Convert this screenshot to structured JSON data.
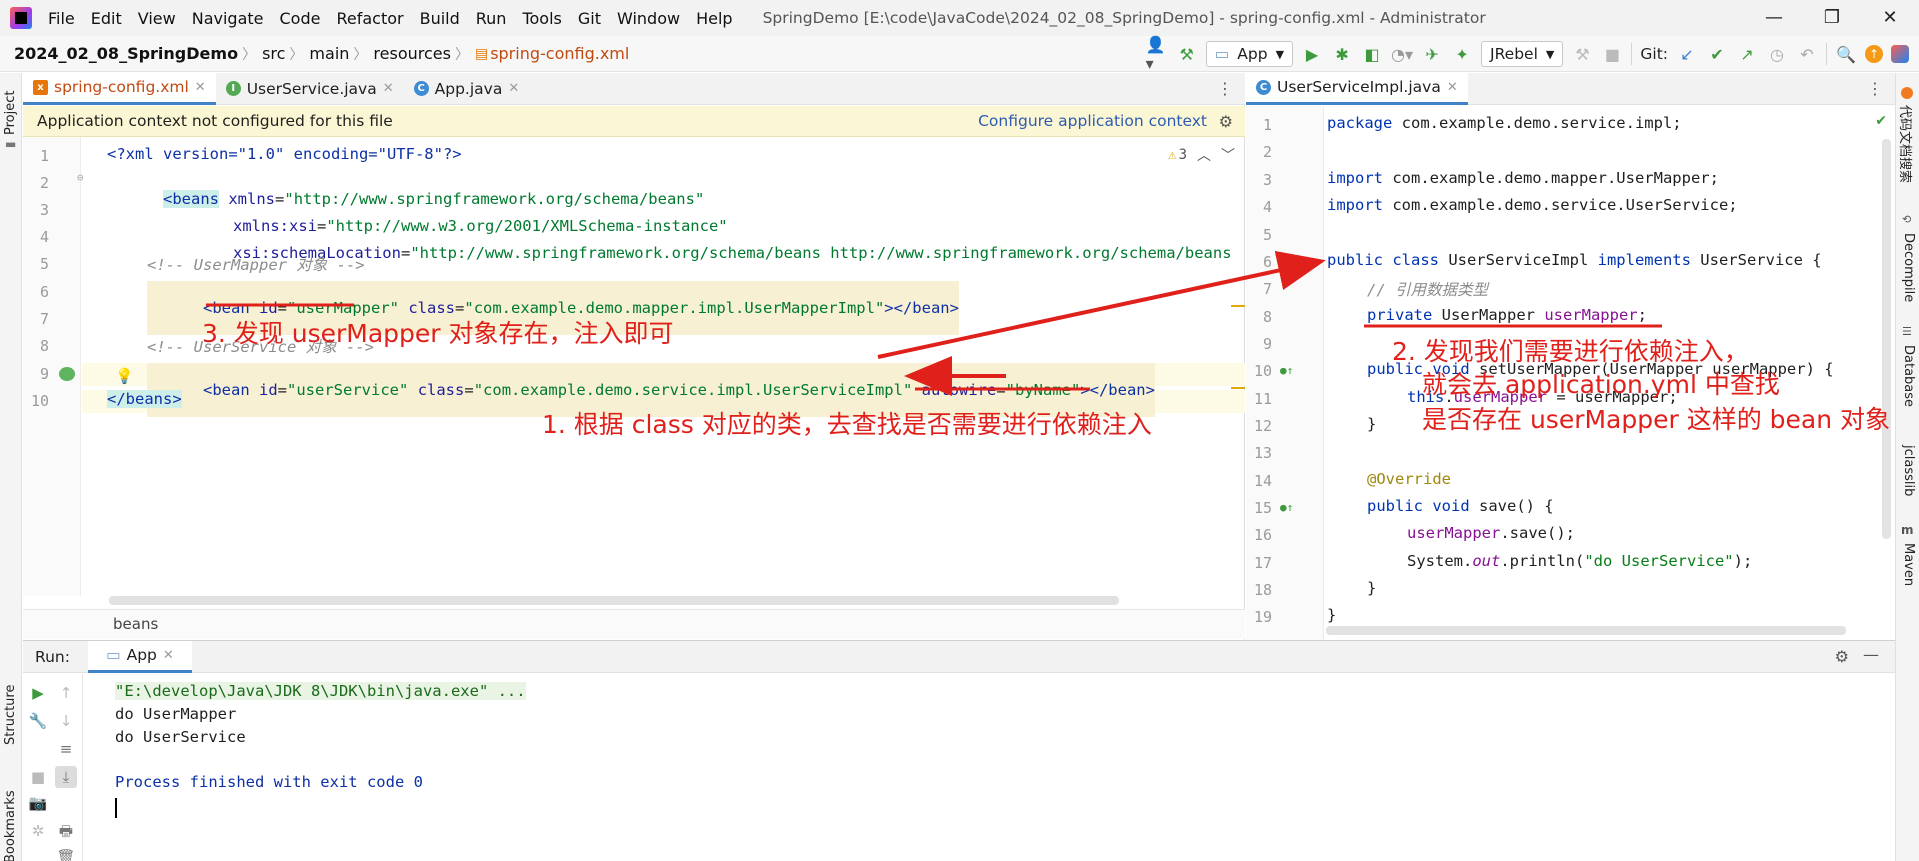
{
  "menubar": {
    "items": [
      "File",
      "Edit",
      "View",
      "Navigate",
      "Code",
      "Refactor",
      "Build",
      "Run",
      "Tools",
      "Git",
      "Window",
      "Help"
    ],
    "title": "SpringDemo [E:\\code\\JavaCode\\2024_02_08_SpringDemo] - spring-config.xml - Administrator"
  },
  "breadcrumb": {
    "project": "2024_02_08_SpringDemo",
    "src": "src",
    "main": "main",
    "resources": "resources",
    "file": "spring-config.xml"
  },
  "toolbar": {
    "run_config": "App",
    "jrebel": "JRebel",
    "git_label": "Git:"
  },
  "left_strip": {
    "project": "Project",
    "structure": "Structure",
    "bookmarks": "Bookmarks"
  },
  "right_strip": {
    "code_search": "代码文档搜索",
    "decompile": "Decompile",
    "database": "Database",
    "jclasslib": "jclasslib",
    "maven": "Maven"
  },
  "left_tabs": [
    {
      "label": "spring-config.xml",
      "icon": "xml-file-icon",
      "color": "#e6760a"
    },
    {
      "label": "UserService.java",
      "icon": "interface-icon",
      "color": "#53a953"
    },
    {
      "label": "App.java",
      "icon": "class-icon",
      "color": "#3d8bd3"
    }
  ],
  "right_tabs": [
    {
      "label": "UserServiceImpl.java",
      "icon": "class-icon",
      "color": "#3d8bd3"
    }
  ],
  "banner": {
    "message": "Application context not configured for this file",
    "link": "Configure application context"
  },
  "inspections": {
    "warnings": "3"
  },
  "xml_lines": {
    "l1": "<?xml version=\"1.0\" encoding=\"UTF-8\"?>",
    "l2_tag": "<beans",
    "l2_attr": "xmlns",
    "l2_val": "\"http://www.springframework.org/schema/beans\"",
    "l3_attr": "xmlns:xsi",
    "l3_val": "\"http://www.w3.org/2001/XMLSchema-instance\"",
    "l4_attr": "xsi:schemaLocation",
    "l4_val": "\"http://www.springframework.org/schema/beans http://www.springframework.org/schema/beans",
    "l5": "<!-- UserMapper 对象 -->",
    "l6_open": "<bean ",
    "l6_id_attr": "id",
    "l6_id_val": "\"userMapper\"",
    "l6_class_attr": "class",
    "l6_class_val": "\"com.example.demo.mapper.impl.UserMapperImpl\"",
    "l6_close": "></bean>",
    "l8": "<!-- UserService 对象 -->",
    "l9_open": "<bean ",
    "l9_id_attr": "id",
    "l9_id_val": "\"userService\"",
    "l9_class_attr": "class",
    "l9_class_val": "\"com.example.demo.service.impl.UserServiceImpl\"",
    "l9_aw_attr": "autowire",
    "l9_aw_val": "\"byName\"",
    "l9_close": "></bean>",
    "l10": "</beans>"
  },
  "java_lines": {
    "l1_kw": "package",
    "l1_rest": " com.example.demo.service.impl;",
    "l3_kw": "import",
    "l3_rest": " com.example.demo.mapper.UserMapper;",
    "l4_kw": "import",
    "l4_rest": " com.example.demo.service.UserService;",
    "l6_kw1": "public class",
    "l6_name": " UserServiceImpl ",
    "l6_kw2": "implements",
    "l6_rest": " UserService {",
    "l7": "// 引用数据类型",
    "l8_kw": "private",
    "l8_type": " UserMapper ",
    "l8_fld": "userMapper",
    "l8_end": ";",
    "l10_kw": "public void",
    "l10_rest": " setUserMapper(UserMapper userMapper) {",
    "l11_kw": "this",
    "l11_dot": ".",
    "l11_fld": "userMapper",
    "l11_rest": " = userMapper;",
    "l12": "}",
    "l14": "@Override",
    "l15_kw": "public void",
    "l15_rest": " save() {",
    "l16_fld": "userMapper",
    "l16_rest": ".save();",
    "l17_pre": "System.",
    "l17_out": "out",
    "l17_mid": ".println(",
    "l17_str": "\"do UserService\"",
    "l17_end": ");",
    "l18": "}",
    "l19": "}"
  },
  "left_footer": "beans",
  "run_panel": {
    "label": "Run:",
    "tab": "App",
    "lines": [
      "\"E:\\develop\\Java\\JDK 8\\JDK\\bin\\java.exe\" ...",
      "do UserMapper",
      "do UserService",
      "",
      "Process finished with exit code 0"
    ]
  },
  "annotations": {
    "a1": "1. 根据 class 对应的类，去查找是否需要进行依赖注入",
    "a2_line1": "2. 发现我们需要进行依赖注入，",
    "a2_line2": "就会去 application.yml 中查找",
    "a2_line3": "是否存在 userMapper 这样的 bean 对象",
    "a3": "3. 发现 userMapper 对象存在，注入即可",
    "color": "#e0201b"
  }
}
